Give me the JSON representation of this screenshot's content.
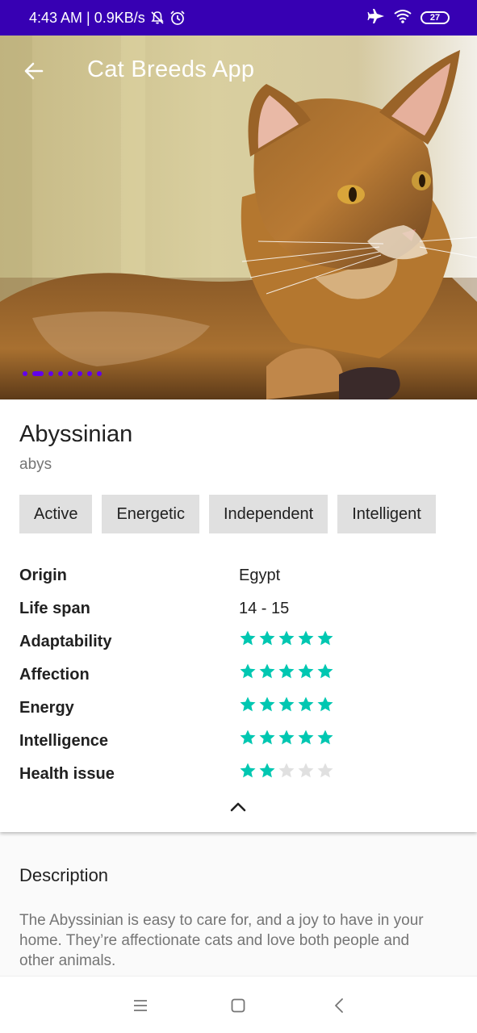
{
  "status_bar": {
    "time_speed": "4:43 AM | 0.9KB/s",
    "battery": "27",
    "icons": [
      "mute-bell-icon",
      "alarm-icon",
      "airplane-icon",
      "wifi-icon",
      "battery-icon"
    ]
  },
  "app_bar": {
    "title": "Cat Breeds App",
    "back_icon": "arrow-back-icon"
  },
  "carousel": {
    "count": 8,
    "active_index": 1,
    "indicator_color": "#6200ee"
  },
  "breed": {
    "name": "Abyssinian",
    "id": "abys",
    "temperament": [
      "Active",
      "Energetic",
      "Independent",
      "Intelligent"
    ]
  },
  "attributes": {
    "origin": {
      "label": "Origin",
      "value": "Egypt"
    },
    "life_span": {
      "label": "Life span",
      "value": "14 - 15"
    },
    "adaptability": {
      "label": "Adaptability",
      "rating": 5,
      "max": 5
    },
    "affection": {
      "label": "Affection",
      "rating": 5,
      "max": 5
    },
    "energy": {
      "label": "Energy",
      "rating": 5,
      "max": 5
    },
    "intelligence": {
      "label": "Intelligence",
      "rating": 5,
      "max": 5
    },
    "health_issues": {
      "label": "Health issue",
      "rating": 2,
      "max": 5
    }
  },
  "description": {
    "title": "Description",
    "text": "The Abyssinian is easy to care for, and a joy to have in your home. They’re affectionate cats and love both people and other animals."
  },
  "colors": {
    "status_bar": "#3700b3",
    "star_filled": "#00c7b1",
    "star_empty": "#e0e0e0",
    "chip_bg": "#e0e0e0"
  },
  "nav_bar": {
    "icons": [
      "menu-icon",
      "home-square-icon",
      "back-chevron-icon"
    ]
  }
}
